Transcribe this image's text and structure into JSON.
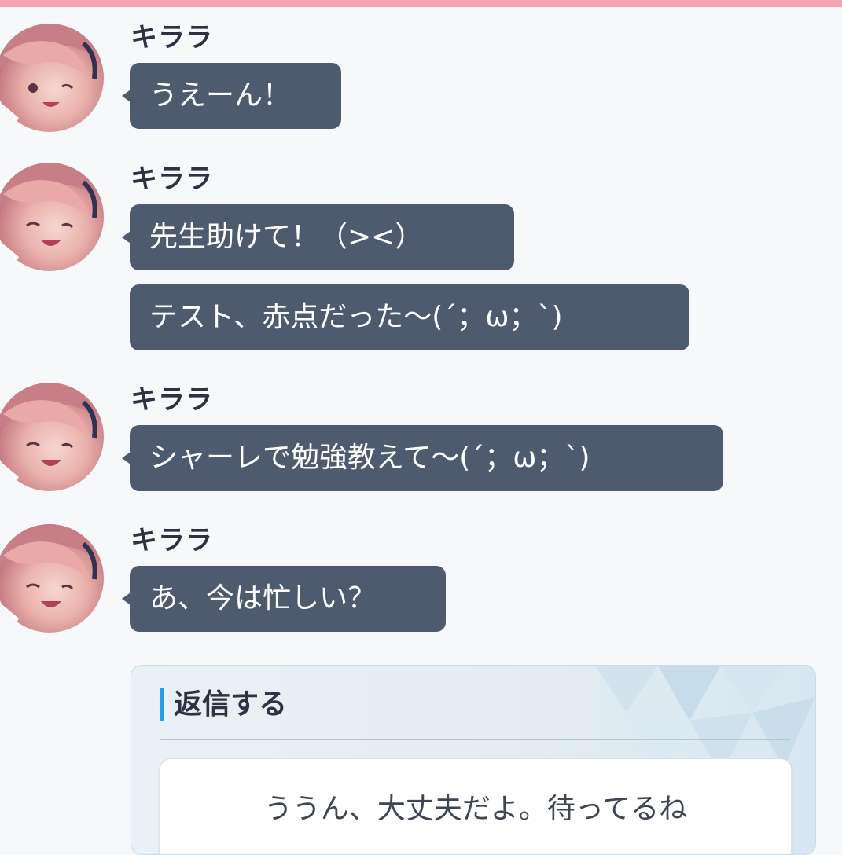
{
  "messages": [
    {
      "sender": "キララ",
      "bubbles": [
        "うえーん！"
      ]
    },
    {
      "sender": "キララ",
      "bubbles": [
        "先生助けて！（><）",
        "テスト、赤点だった〜(´；ω；`)"
      ]
    },
    {
      "sender": "キララ",
      "bubbles": [
        "シャーレで勉強教えて〜(´；ω；`)"
      ]
    },
    {
      "sender": "キララ",
      "bubbles": [
        "あ、今は忙しい？"
      ]
    }
  ],
  "reply": {
    "title": "返信する",
    "options": [
      "ううん、大丈夫だよ。待ってるね"
    ]
  },
  "colors": {
    "top_bar": "#f4a2b2",
    "bubble_bg": "#4e5b6f",
    "accent": "#2a9be6"
  },
  "icons": {
    "avatar": "character-avatar"
  }
}
